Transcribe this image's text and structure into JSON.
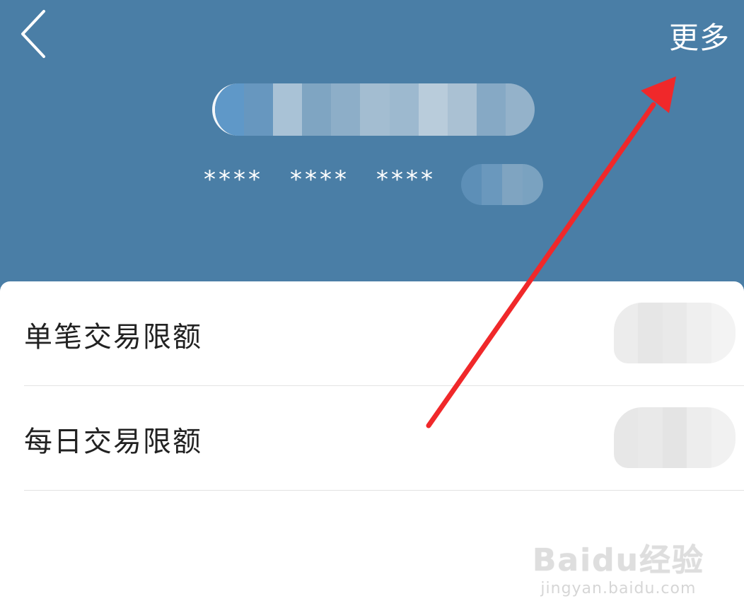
{
  "header": {
    "more_label": "更多",
    "card_number_groups": [
      "****",
      "****",
      "****"
    ],
    "background_color": "#4a7ea6"
  },
  "icons": {
    "back": "chevron-left-icon"
  },
  "limits": {
    "items": [
      {
        "label": "单笔交易限额"
      },
      {
        "label": "每日交易限额"
      }
    ]
  },
  "annotation": {
    "type": "red-arrow",
    "color": "#f0282a",
    "points_to": "更多"
  },
  "watermark": {
    "logo": "Baidu经验",
    "url": "jingyan.baidu.com"
  }
}
